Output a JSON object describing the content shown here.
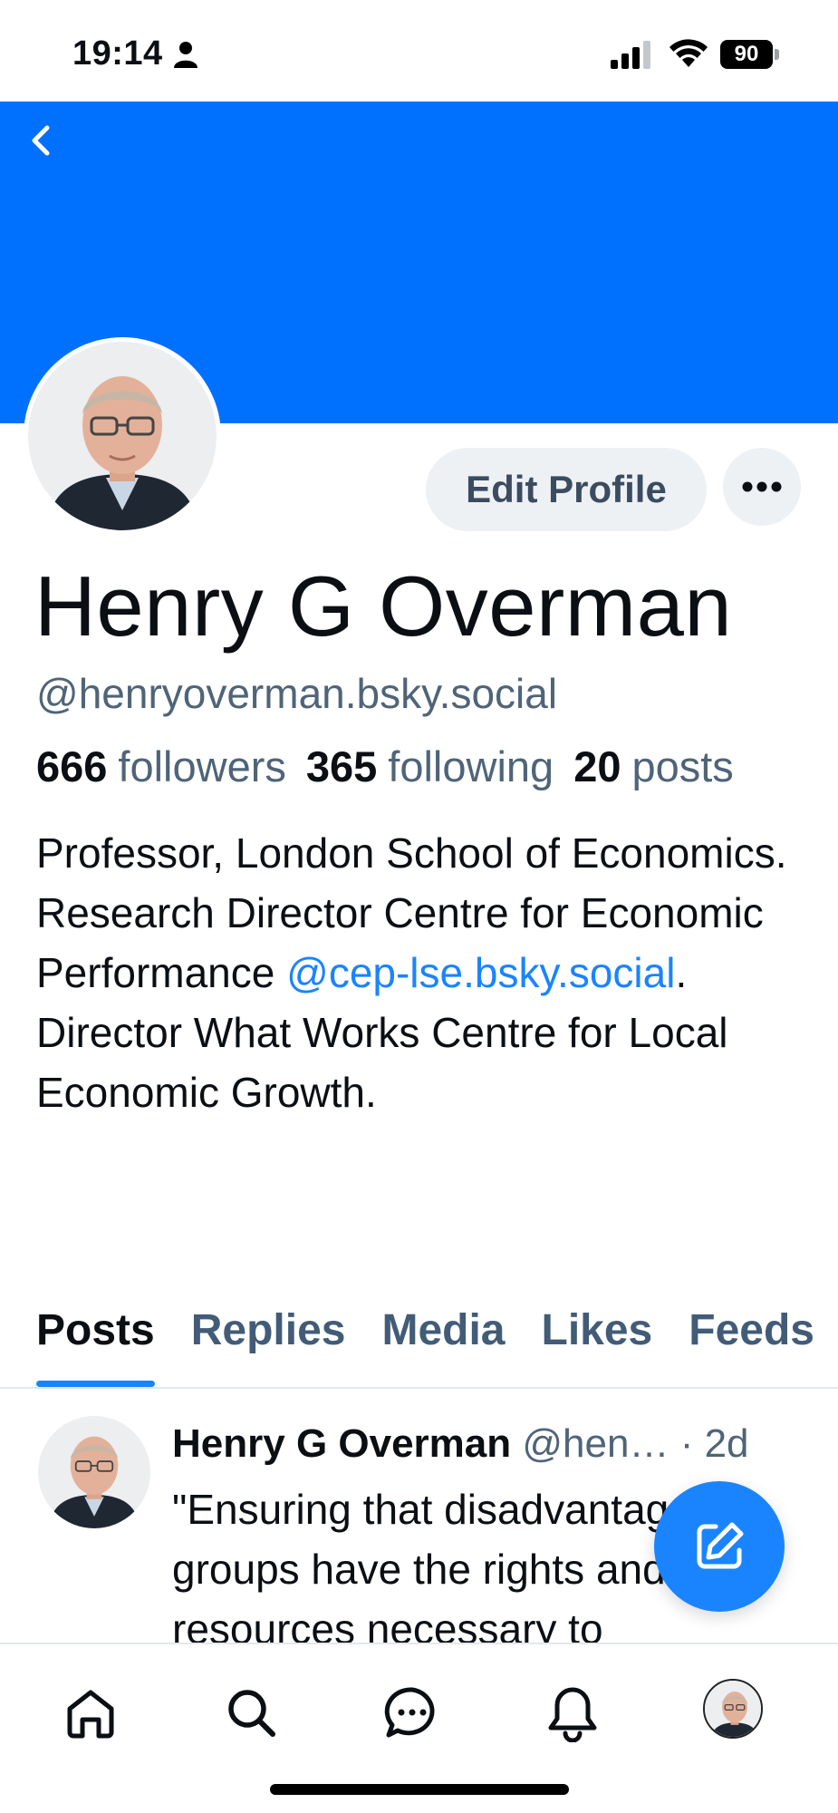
{
  "status_bar": {
    "time": "19:14",
    "battery": "90"
  },
  "profile": {
    "display_name": "Henry G Overman",
    "handle": "@henryoverman.bsky.social",
    "edit_label": "Edit Profile",
    "followers_count": "666",
    "followers_label": "followers",
    "following_count": "365",
    "following_label": "following",
    "posts_count": "20",
    "posts_label": "posts",
    "bio_part1": "Professor, London School of Economics. Research Director Centre for Economic Performance ",
    "bio_mention": "@cep-lse.bsky.social",
    "bio_part2": ". Director What Works Centre for Local Economic Growth."
  },
  "tabs": [
    {
      "label": "Posts"
    },
    {
      "label": "Replies"
    },
    {
      "label": "Media"
    },
    {
      "label": "Likes"
    },
    {
      "label": "Feeds"
    }
  ],
  "post": {
    "author": "Henry G Overman",
    "handle_truncated": "@hen…",
    "separator": " · ",
    "age": "2d",
    "text": "\"Ensuring that disadvantaged groups have the rights and resources necessary to"
  },
  "colors": {
    "banner": "#0070ff",
    "accent": "#1a84ff"
  }
}
